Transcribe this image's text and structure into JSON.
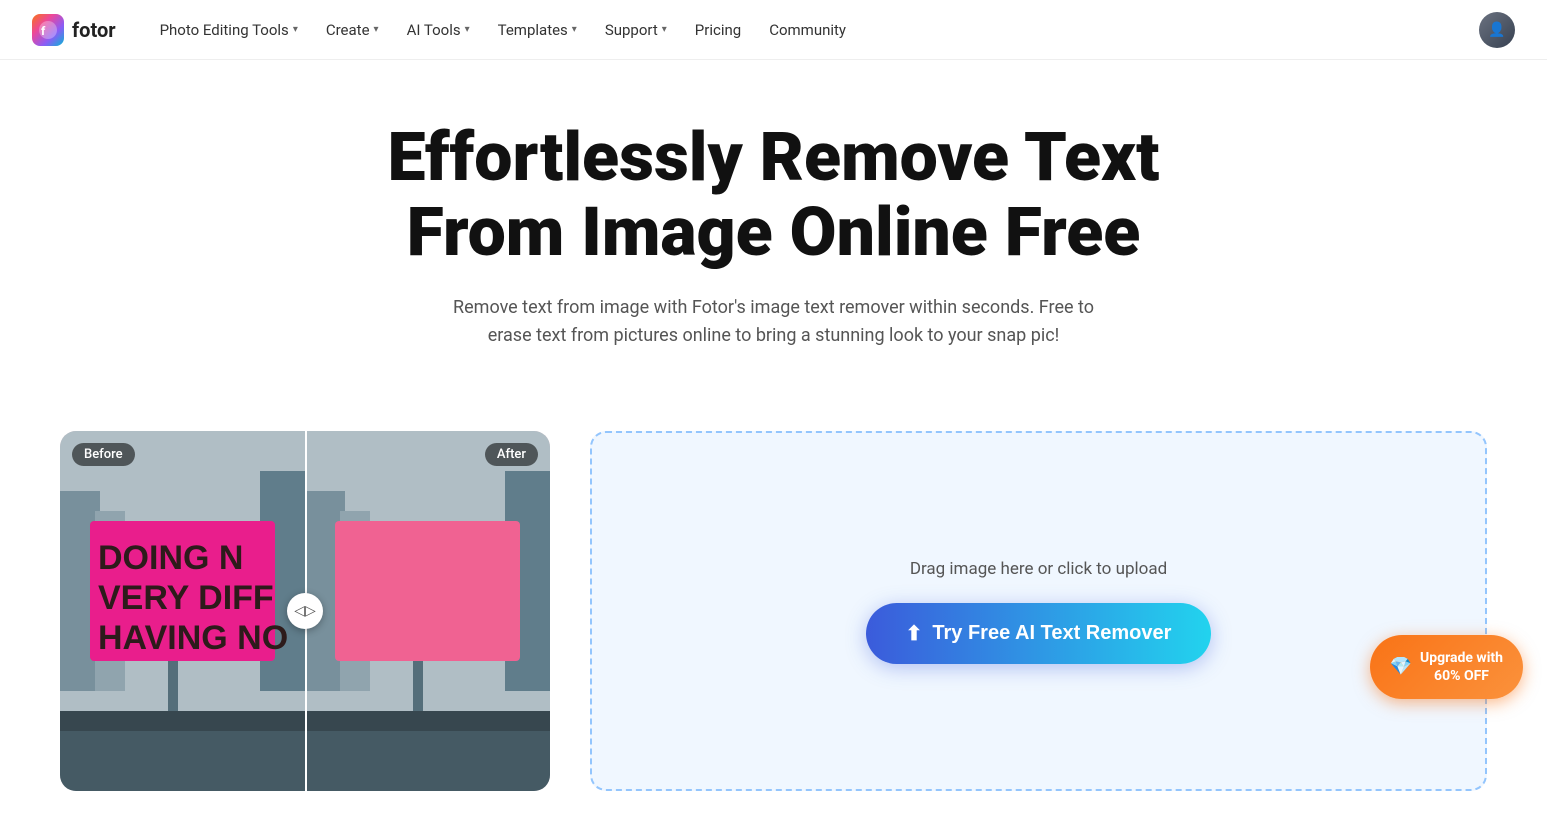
{
  "logo": {
    "text": "fotor"
  },
  "nav": {
    "items": [
      {
        "label": "Photo Editing Tools",
        "hasDropdown": true
      },
      {
        "label": "Create",
        "hasDropdown": true
      },
      {
        "label": "AI Tools",
        "hasDropdown": true
      },
      {
        "label": "Templates",
        "hasDropdown": true
      },
      {
        "label": "Support",
        "hasDropdown": true
      },
      {
        "label": "Pricing",
        "hasDropdown": false
      },
      {
        "label": "Community",
        "hasDropdown": false
      }
    ]
  },
  "hero": {
    "title": "Effortlessly Remove Text From Image Online Free",
    "subtitle": "Remove text from image with Fotor's image text remover within seconds. Free to erase text from pictures online to bring a stunning look to your snap pic!"
  },
  "before_after": {
    "before_label": "Before",
    "after_label": "After",
    "billboard_text_line1": "DOING N",
    "billboard_text_line2": "VERY DIFFE",
    "billboard_text_line3": "HAVING NO"
  },
  "upload": {
    "hint": "Drag image here or click to upload",
    "button_label": "Try Free AI Text Remover"
  },
  "upgrade": {
    "label": "Upgrade with\n60% OFF"
  }
}
